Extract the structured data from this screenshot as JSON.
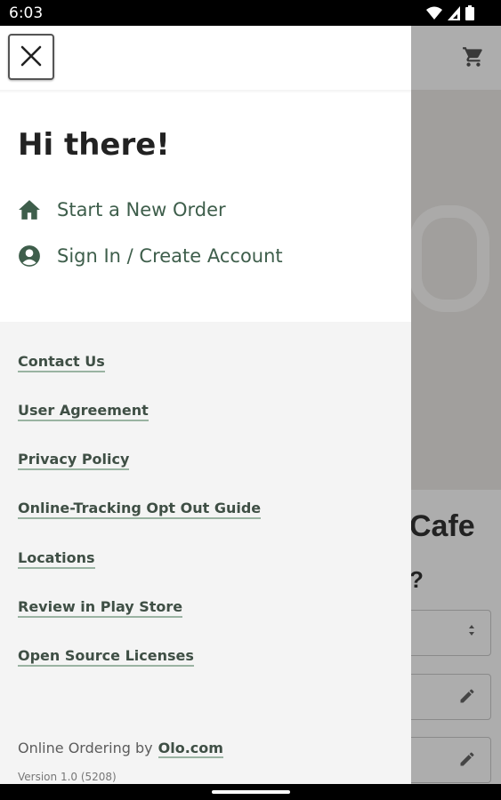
{
  "status_bar": {
    "time": "6:03",
    "icons": [
      "wifi-icon",
      "signal-icon",
      "battery-icon"
    ]
  },
  "background_app": {
    "title_fragment": "Cafe",
    "question_fragment": "?",
    "cart_icon": "cart-icon",
    "field_icons": [
      "select-arrows-icon",
      "pencil-icon",
      "pencil-icon"
    ]
  },
  "drawer": {
    "close_icon": "close-icon",
    "greeting": "Hi there!",
    "menu_items": [
      {
        "label": "Start a New Order",
        "icon": "home-icon"
      },
      {
        "label": "Sign In / Create Account",
        "icon": "account-circle-icon"
      }
    ],
    "links": [
      "Contact Us",
      "User Agreement",
      "Privacy Policy",
      "Online-Tracking Opt Out Guide",
      "Locations",
      "Review in Play Store",
      "Open Source Licenses"
    ],
    "footer": {
      "prefix": "Online Ordering by",
      "brand": "Olo.com",
      "version": "Version 1.0 (5208)"
    }
  },
  "colors": {
    "accent_green": "#3e5e4b",
    "link_underline": "#9ab3a2",
    "drawer_bg": "#f4f4f4"
  }
}
